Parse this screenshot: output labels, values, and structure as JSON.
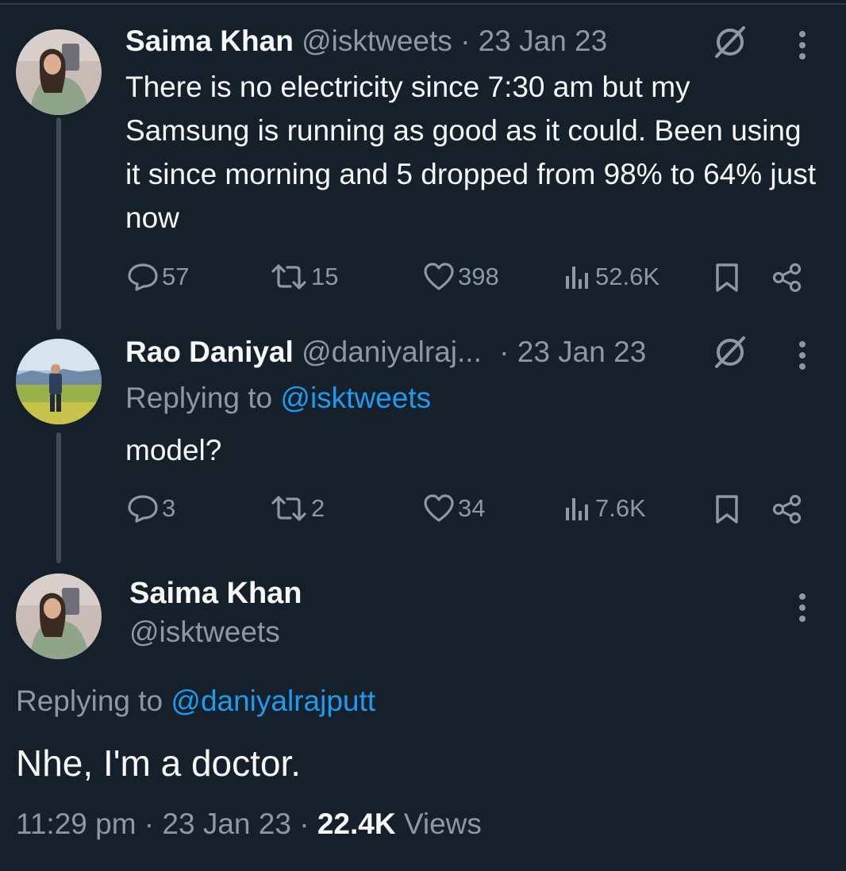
{
  "tweet1": {
    "name": "Saima Khan",
    "handle": "@isktweets",
    "date": "· 23 Jan 23",
    "text": "There is no electricity since 7:30 am but my Samsung is running as good as it could. Been using it since morning and 5 dropped from 98% to 64% just now",
    "replies": "57",
    "retweets": "15",
    "likes": "398",
    "views": "52.6K"
  },
  "tweet2": {
    "name": "Rao Daniyal",
    "handle": "@daniyalraj...",
    "date": "· 23 Jan 23",
    "replying_prefix": "Replying to ",
    "replying_handle": "@isktweets",
    "text": "model?",
    "replies": "3",
    "retweets": "2",
    "likes": "34",
    "views": "7.6K"
  },
  "main": {
    "name": "Saima Khan",
    "handle": "@isktweets",
    "replying_prefix": "Replying to ",
    "replying_handle": "@daniyalrajputt",
    "text": "Nhe, I'm a doctor.",
    "time": "11:29 pm",
    "date": "23 Jan 23",
    "views_count": "22.4K",
    "views_label": "Views",
    "separator": " · "
  },
  "icons": {
    "reply": "reply-icon",
    "retweet": "retweet-icon",
    "like": "heart-icon",
    "views": "views-icon",
    "bookmark": "bookmark-icon",
    "share": "share-icon",
    "more": "more-icon",
    "grok": "grok-icon"
  },
  "colors": {
    "background": "#15202b",
    "text": "#f7f9f9",
    "muted": "#8b98a5",
    "accent": "#1d9bf0"
  }
}
